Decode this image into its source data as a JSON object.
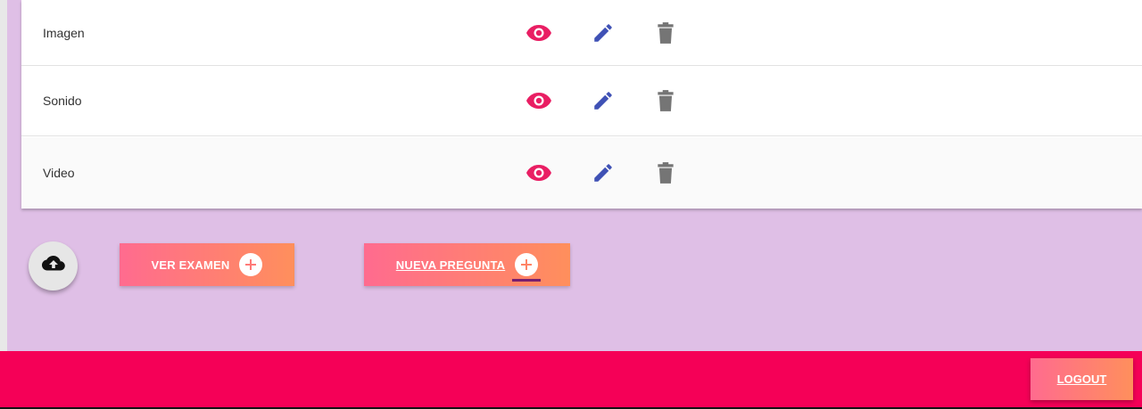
{
  "table": {
    "rows": [
      {
        "label": "Imagen"
      },
      {
        "label": "Sonido"
      },
      {
        "label": "Video"
      }
    ]
  },
  "actions": {
    "ver_examen_label": "VER EXAMEN",
    "nueva_pregunta_label": "NUEVA PREGUNTA",
    "upload_icon": "cloud-upload-icon",
    "add_icon": "add-circle-icon"
  },
  "footer": {
    "logout_label": "LOGOUT"
  },
  "colors": {
    "background": "#dfbfe6",
    "footer": "#f50057",
    "eye_icon": "#e91e63",
    "edit_icon": "#3f51b5",
    "delete_icon": "#757575",
    "button_gradient_start": "#ff6b8f",
    "button_gradient_end": "#ff8f5c"
  }
}
